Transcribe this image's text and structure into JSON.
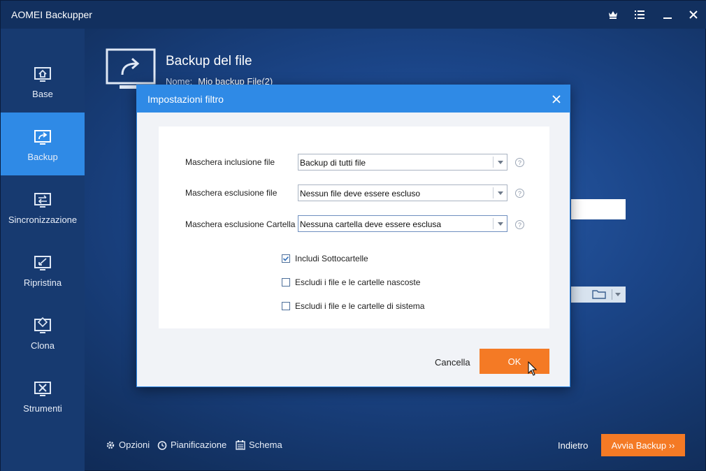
{
  "app": {
    "title": "AOMEI Backupper"
  },
  "titlebar": {
    "icons": [
      "crown-icon",
      "menu-icon",
      "minimize-icon",
      "close-icon"
    ]
  },
  "sidebar": {
    "items": [
      {
        "label": "Base",
        "icon": "home-monitor-icon",
        "active": false
      },
      {
        "label": "Backup",
        "icon": "backup-monitor-icon",
        "active": true
      },
      {
        "label": "Sincronizzazione",
        "icon": "sync-monitor-icon",
        "active": false
      },
      {
        "label": "Ripristina",
        "icon": "restore-monitor-icon",
        "active": false
      },
      {
        "label": "Clona",
        "icon": "clone-monitor-icon",
        "active": false
      },
      {
        "label": "Strumenti",
        "icon": "tools-monitor-icon",
        "active": false
      }
    ]
  },
  "main": {
    "title": "Backup del file",
    "name_label": "Nome:",
    "name_value": "Mio backup File(2)"
  },
  "bottom": {
    "options": "Opzioni",
    "schedule": "Pianificazione",
    "scheme": "Schema",
    "back": "Indietro",
    "start": "Avvia Backup ››"
  },
  "dialog": {
    "title": "Impostazioni filtro",
    "fields": [
      {
        "label": "Maschera inclusione file",
        "value": "Backup di tutti file"
      },
      {
        "label": "Maschera esclusione file",
        "value": "Nessun file deve essere escluso"
      },
      {
        "label": "Maschera esclusione Cartella",
        "value": "Nessuna cartella deve essere esclusa"
      }
    ],
    "checkboxes": [
      {
        "label": "Includi Sottocartelle",
        "checked": true
      },
      {
        "label": "Escludi i file e le cartelle nascoste",
        "checked": false
      },
      {
        "label": "Escludi i file e le cartelle di sistema",
        "checked": false
      }
    ],
    "cancel": "Cancella",
    "ok": "OK"
  },
  "colors": {
    "accent": "#2f8ae6",
    "orange": "#f47a25",
    "sidebar": "#173a70",
    "titlebar": "#12305f"
  }
}
